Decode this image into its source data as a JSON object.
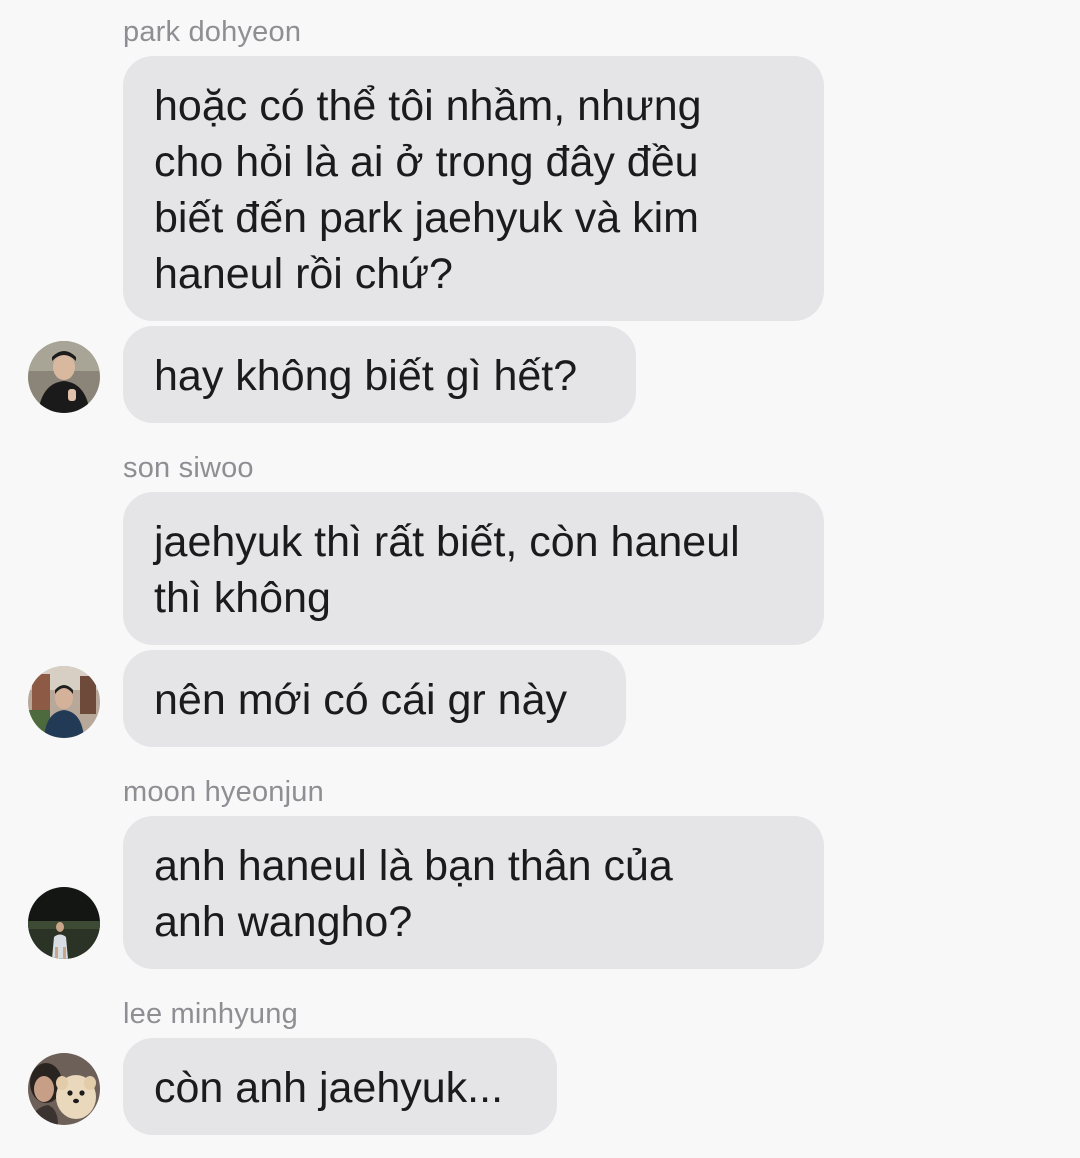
{
  "conversation": {
    "groups": [
      {
        "sender": "park dohyeon",
        "avatar_icon": "person-photo-avatar",
        "messages": [
          "hoặc có thể tôi nhầm, nhưng\ncho hỏi là ai ở trong đây đều\nbiết đến park jaehyuk và kim\nhaneul rồi chứ?",
          "hay không biết gì hết?"
        ]
      },
      {
        "sender": "son siwoo",
        "avatar_icon": "person-photo-avatar",
        "messages": [
          "jaehyuk thì rất biết, còn haneul\nthì không",
          "nên mới có cái gr này"
        ]
      },
      {
        "sender": "moon hyeonjun",
        "avatar_icon": "person-photo-avatar",
        "messages": [
          "anh haneul là bạn thân của\nanh wangho?"
        ]
      },
      {
        "sender": "lee minhyung",
        "avatar_icon": "person-with-dog-avatar",
        "messages": [
          "còn anh jaehyuk..."
        ]
      }
    ]
  },
  "colors": {
    "background": "#f8f8f9",
    "bubble": "#e5e5e8",
    "text": "#1b1b1d",
    "sender_name": "#8e8e93"
  }
}
